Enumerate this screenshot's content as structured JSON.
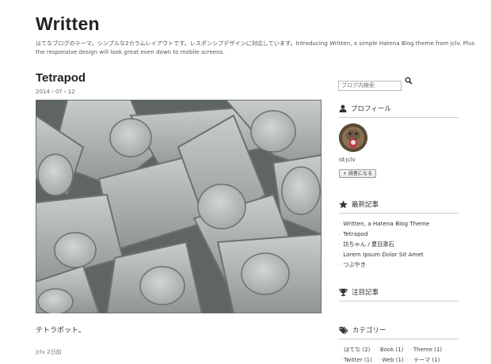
{
  "blog": {
    "title": "Written",
    "description": "はてなブログのテーマ。シンプルな2カラムレイアウトです。レスポンシブデザインに対応しています。Introducing Written, a simple Hatena Blog theme from jclv. Plus the responsive design will look great even down to mobile screens."
  },
  "entry": {
    "title": "Tetrapod",
    "date": "2014・07・12",
    "body": "テトラポット。",
    "author": "jclv",
    "relative_time": "2日前"
  },
  "sidebar": {
    "search_placeholder": "ブログ内検索",
    "profile": {
      "heading": "プロフィール",
      "user_id": "id:jclv",
      "subscribe_label": "読者になる"
    },
    "recent": {
      "heading": "最新記事",
      "items": [
        "Written, a Hatena Blog Theme",
        "Tetrapod",
        "坊ちゃん / 夏目漱石",
        "Lorem Ipsum Dolor Sit Amet",
        "つぶやき"
      ]
    },
    "featured": {
      "heading": "注目記事"
    },
    "categories": {
      "heading": "カテゴリー",
      "row1": [
        "はてな (2)",
        "Book (1)",
        "Theme (1)"
      ],
      "row2": [
        "Twitter (1)",
        "Web (1)",
        "テーマ (1)"
      ]
    }
  },
  "icons": {
    "profile": "person-icon",
    "recent": "star-icon",
    "featured": "trophy-icon",
    "categories": "tags-icon",
    "search": "search-icon"
  },
  "colors": {
    "text": "#333333",
    "rule": "#cccccc",
    "background": "#ffffff"
  }
}
